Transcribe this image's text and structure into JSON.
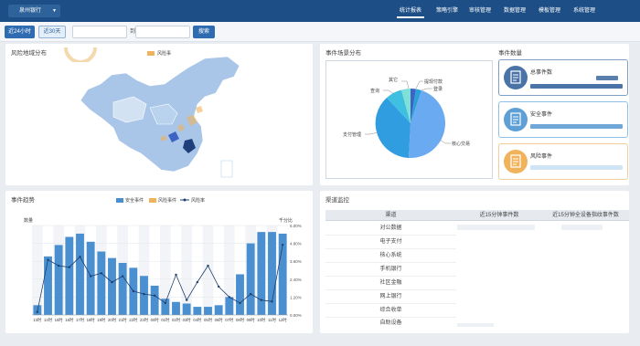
{
  "header": {
    "bank_selector": "泉州银行",
    "nav": [
      "统计报表",
      "策略引擎",
      "审核管理",
      "数据管理",
      "模板管理",
      "系统管理"
    ]
  },
  "filter": {
    "btn_24h": "近24小时",
    "btn_30d": "近30天",
    "to_label": "到",
    "search": "搜索"
  },
  "map_panel": {
    "title": "风险地域分布",
    "legend": "风险事"
  },
  "scene_panel": {
    "title": "事件场景分布",
    "labels": [
      "其它",
      "提现付款",
      "登录",
      "核心交易",
      "支付管理",
      "查询"
    ]
  },
  "count_panel": {
    "title": "事件数量",
    "cards": [
      {
        "label": "总事件数",
        "icon": "document-icon",
        "color": "#4a74a8"
      },
      {
        "label": "安全事件",
        "icon": "document-icon",
        "color": "#5e9fd6"
      },
      {
        "label": "风险事件",
        "icon": "document-icon",
        "color": "#f0b35c"
      }
    ]
  },
  "trend_panel": {
    "title": "事件趋势",
    "legend": [
      "安全事件",
      "风险事件",
      "风险率"
    ],
    "y_left_title": "数量",
    "y_right_title": "千分比",
    "y_right_ticks": [
      "6.00%",
      "4.80%",
      "3.60%",
      "2.40%",
      "1.20%",
      "0.00%"
    ]
  },
  "channel_panel": {
    "title": "渠道监控",
    "columns": [
      "渠道",
      "近15分钟事件数",
      "近15分钟全设备指纹事件数"
    ],
    "rows": [
      "对公数据",
      "电子支付",
      "核心系统",
      "手机银行",
      "社区金融",
      "网上银行",
      "综合收单",
      "自助设备"
    ]
  },
  "chart_data": {
    "type": "bar",
    "categories": [
      "13时",
      "14时",
      "15时",
      "16时",
      "17时",
      "18时",
      "19时",
      "20时",
      "21时",
      "22时",
      "23时",
      "00时",
      "01时",
      "02时",
      "03时",
      "04时",
      "05时",
      "06时",
      "07时",
      "08时",
      "09时",
      "10时",
      "11时",
      "12时"
    ],
    "series": [
      {
        "name": "安全事件",
        "type": "bar",
        "values": [
          0.6,
          3.6,
          4.3,
          4.8,
          5.0,
          4.5,
          3.9,
          3.5,
          3.2,
          2.9,
          2.4,
          1.8,
          1.0,
          0.8,
          0.7,
          0.5,
          0.5,
          0.6,
          1.1,
          2.5,
          4.4,
          5.1,
          5.1,
          5.0
        ]
      },
      {
        "name": "风险事件",
        "type": "bar",
        "values": [
          0,
          0,
          0,
          0,
          0,
          0,
          0,
          0,
          0,
          0,
          0,
          0,
          0,
          0,
          0,
          0,
          0,
          0,
          0,
          0,
          0,
          0,
          0,
          0
        ]
      },
      {
        "name": "风险率",
        "type": "line",
        "values": [
          0.2,
          3.7,
          3.3,
          3.2,
          3.9,
          2.6,
          2.8,
          2.2,
          2.6,
          1.6,
          1.4,
          1.3,
          0.8,
          2.7,
          1.0,
          2.2,
          3.3,
          1.9,
          1.2,
          0.8,
          1.4,
          1.0,
          0.9,
          4.7
        ]
      }
    ],
    "y_right_range": [
      0,
      6.0
    ],
    "grid": true,
    "legend_position": "top"
  }
}
